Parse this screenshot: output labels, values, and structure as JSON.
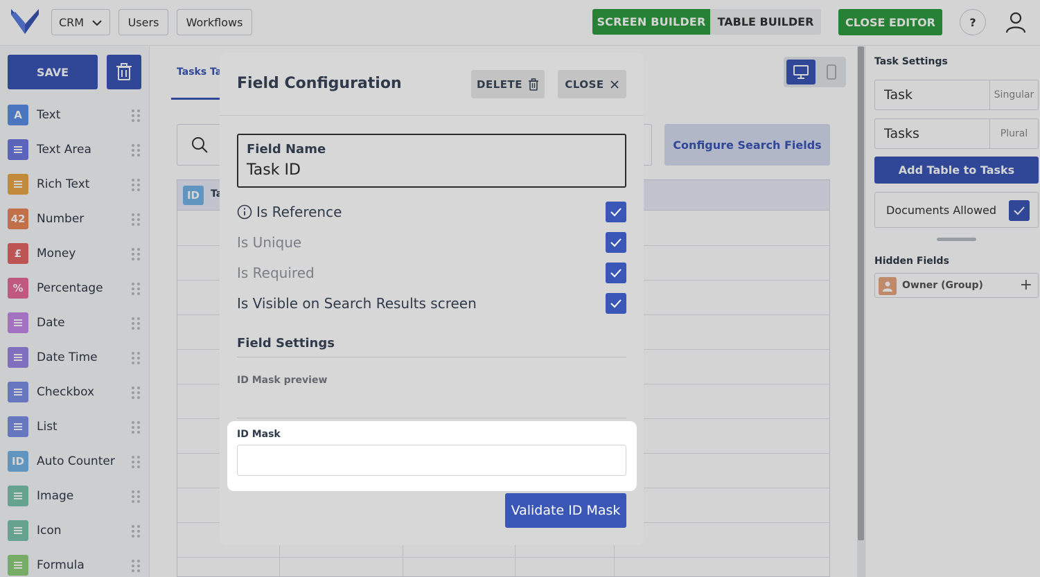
{
  "topbar": {
    "app_menu": "CRM",
    "users": "Users",
    "workflows": "Workflows",
    "screen_builder": "SCREEN BUILDER",
    "table_builder": "TABLE BUILDER",
    "close_editor": "CLOSE EDITOR",
    "help": "?"
  },
  "sidebar": {
    "save": "SAVE",
    "items": [
      {
        "label": "Text",
        "icon_text": "A",
        "icon": "text-icon",
        "color": "#5b8ee6"
      },
      {
        "label": "Text Area",
        "icon_text": "",
        "icon": "textarea-icon",
        "color": "#6b79e0"
      },
      {
        "label": "Rich Text",
        "icon_text": "",
        "icon": "richtext-icon",
        "color": "#e8a64a"
      },
      {
        "label": "Number",
        "icon_text": "42",
        "icon": "number-icon",
        "color": "#e9875a"
      },
      {
        "label": "Money",
        "icon_text": "£",
        "icon": "money-icon",
        "color": "#e26565"
      },
      {
        "label": "Percentage",
        "icon_text": "%",
        "icon": "percentage-icon",
        "color": "#e76a9b"
      },
      {
        "label": "Date",
        "icon_text": "",
        "icon": "calendar-icon",
        "color": "#c38ae8"
      },
      {
        "label": "Date Time",
        "icon_text": "",
        "icon": "clock-icon",
        "color": "#9a86e4"
      },
      {
        "label": "Checkbox",
        "icon_text": "",
        "icon": "checkbox-icon",
        "color": "#7b8fe6"
      },
      {
        "label": "List",
        "icon_text": "",
        "icon": "list-icon",
        "color": "#7b8fe6"
      },
      {
        "label": "Auto Counter",
        "icon_text": "ID",
        "icon": "auto-counter-icon",
        "color": "#74b4e6"
      },
      {
        "label": "Image",
        "icon_text": "",
        "icon": "image-icon",
        "color": "#7ac4ad"
      },
      {
        "label": "Icon",
        "icon_text": "",
        "icon": "icon-field-icon",
        "color": "#7ac4ad"
      },
      {
        "label": "Formula",
        "icon_text": "",
        "icon": "formula-icon",
        "color": "#8fcf7a"
      }
    ]
  },
  "main": {
    "tab_label": "Tasks Tal",
    "configure_search": "Configure Search Fields",
    "table_header": "Ta",
    "id_badge": "ID"
  },
  "right_panel": {
    "title": "Task  Settings",
    "singular_value": "Task",
    "singular_label": "Singular",
    "plural_value": "Tasks",
    "plural_label": "Plural",
    "add_table": "Add Table to Tasks",
    "documents_allowed": "Documents Allowed",
    "hidden_fields_title": "Hidden Fields",
    "hidden_fields": [
      {
        "label": "Owner (Group)"
      }
    ]
  },
  "modal": {
    "title": "Field Configuration",
    "delete": "DELETE",
    "close": "CLOSE",
    "field_name_label": "Field Name",
    "field_name_value": "Task ID",
    "checks": [
      {
        "label": "Is Reference",
        "checked": true,
        "info": true,
        "muted": false
      },
      {
        "label": "Is Unique",
        "checked": true,
        "info": false,
        "muted": true
      },
      {
        "label": "Is Required",
        "checked": true,
        "info": false,
        "muted": true
      },
      {
        "label": "Is Visible on Search Results screen",
        "checked": true,
        "info": false,
        "muted": false
      }
    ],
    "field_settings_title": "Field Settings",
    "mask_preview_label": "ID Mask preview",
    "mask_label": "ID Mask",
    "mask_value": "",
    "validate": "Validate ID Mask"
  },
  "colors": {
    "primary": "#3a56b7",
    "success": "#2e9c3f"
  }
}
